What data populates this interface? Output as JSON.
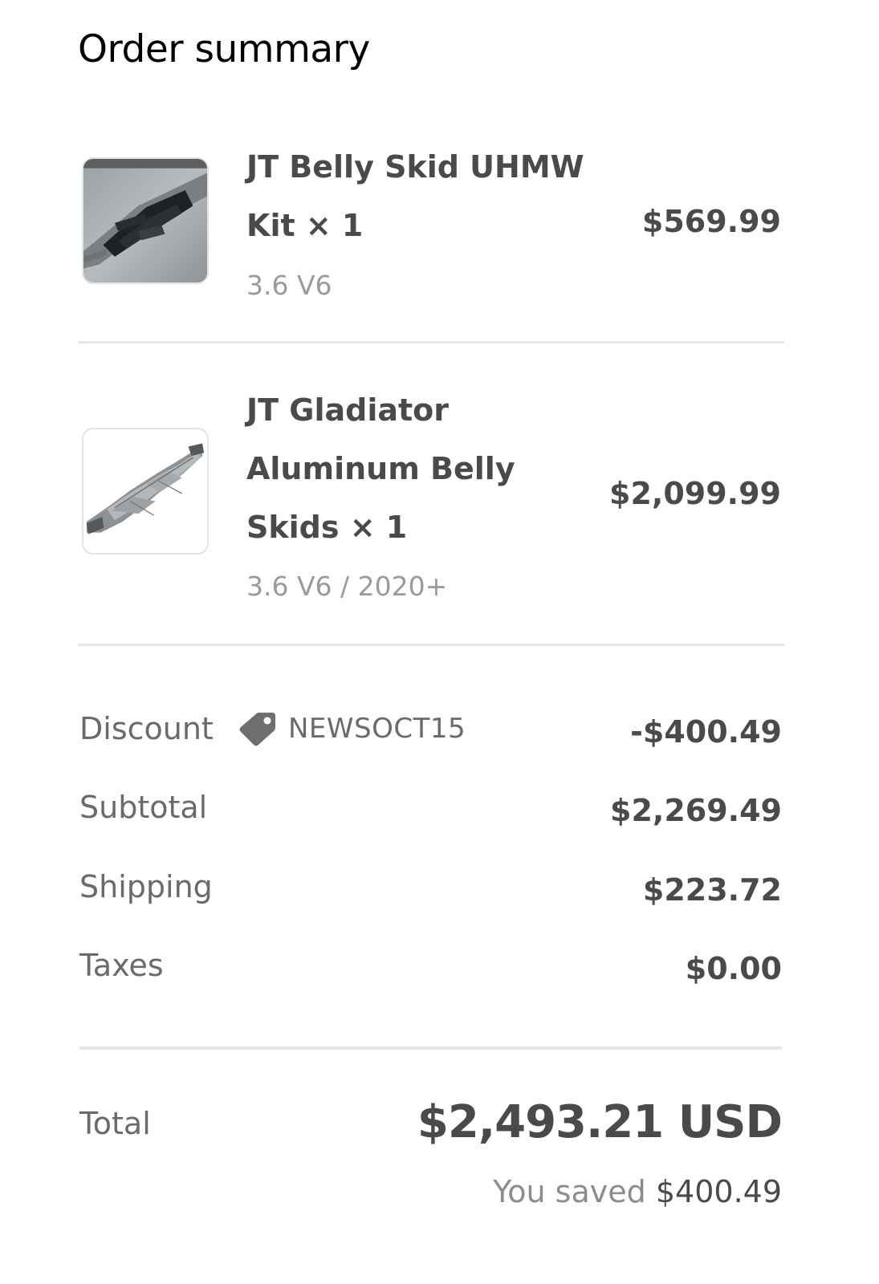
{
  "header": {
    "title": "Order summary"
  },
  "items": [
    {
      "name_lines": [
        "JT Belly Skid UHMW",
        "Kit × 1"
      ],
      "variant": "3.6 V6",
      "price": "$569.99",
      "thumbnail": "product-photo"
    },
    {
      "name_lines": [
        "JT Gladiator",
        "Aluminum Belly",
        "Skids × 1"
      ],
      "variant": "3.6 V6 / 2020+",
      "price": "$2,099.99",
      "thumbnail": "product-render"
    }
  ],
  "summary": {
    "discount": {
      "label": "Discount",
      "code": "NEWSOCT15",
      "icon": "tag-icon",
      "value": "-$400.49"
    },
    "subtotal": {
      "label": "Subtotal",
      "value": "$2,269.49"
    },
    "shipping": {
      "label": "Shipping",
      "value": "$223.72"
    },
    "taxes": {
      "label": "Taxes",
      "value": "$0.00"
    }
  },
  "total": {
    "label": "Total",
    "value": "$2,493.21 USD",
    "saved_label": "You saved",
    "saved_amount": "$400.49"
  },
  "colors": {
    "text_primary": "#4a4a4a",
    "text_secondary": "#9a9a9a",
    "divider": "#e6e6e6",
    "title": "#000000"
  }
}
